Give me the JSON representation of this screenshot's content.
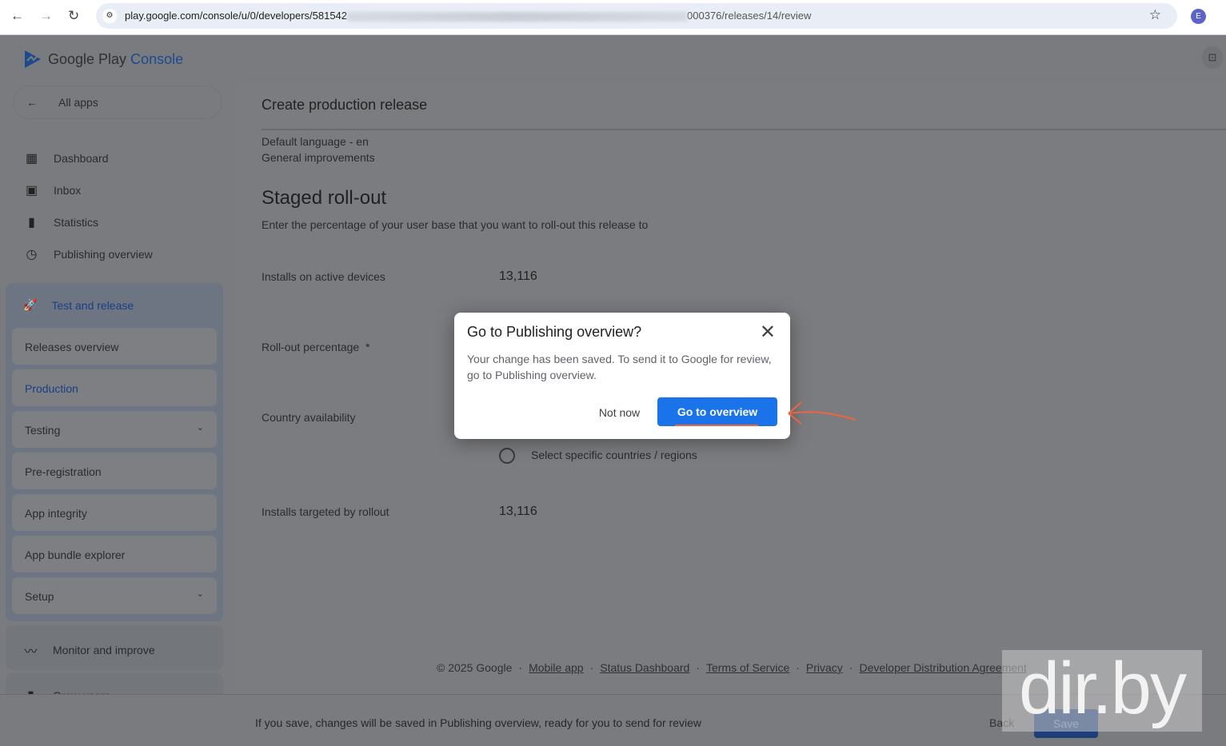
{
  "browser": {
    "url_start": "play.google.com/console/u/0/developers/581542",
    "url_end": "000376/releases/14/review",
    "profile_initial": "E"
  },
  "brand": {
    "google_play": "Google Play",
    "console": "Console"
  },
  "sidebar": {
    "all_apps": "All apps",
    "items": [
      {
        "label": "Dashboard"
      },
      {
        "label": "Inbox"
      },
      {
        "label": "Statistics"
      },
      {
        "label": "Publishing overview"
      }
    ],
    "group": {
      "label": "Test and release",
      "subitems": [
        {
          "label": "Releases overview"
        },
        {
          "label": "Production"
        },
        {
          "label": "Testing"
        },
        {
          "label": "Pre-registration"
        },
        {
          "label": "App integrity"
        },
        {
          "label": "App bundle explorer"
        },
        {
          "label": "Setup"
        }
      ]
    },
    "monitor": "Monitor and improve",
    "grow": "Grow users"
  },
  "main": {
    "title": "Create production release",
    "language": "Default language - en",
    "notes": "General improvements",
    "section_title": "Staged roll-out",
    "section_desc": "Enter the percentage of your user base that you want to roll-out this release to",
    "installs_label": "Installs on active devices",
    "installs_value": "13,116",
    "rollout_label": "Roll-out percentage",
    "required": "*",
    "country_label": "Country availability",
    "radio_option": "Select specific countries / regions",
    "targeted_label": "Installs targeted by rollout",
    "targeted_value": "13,116"
  },
  "footer": {
    "copyright": "© 2025 Google",
    "links": [
      "Mobile app",
      "Status Dashboard",
      "Terms of Service",
      "Privacy",
      "Developer Distribution Agreement"
    ]
  },
  "bottom": {
    "message": "If you save, changes will be saved in Publishing overview, ready for you to send for review",
    "back": "Back",
    "save": "Save"
  },
  "dialog": {
    "title": "Go to Publishing overview?",
    "body": "Your change has been saved. To send it to Google for review, go to Publishing overview.",
    "not_now": "Not now",
    "go": "Go to overview"
  },
  "watermark": "dir.by",
  "colors": {
    "primary": "#1a73e8",
    "annotation": "#f0643e",
    "overlay": "#7a7b7e"
  }
}
